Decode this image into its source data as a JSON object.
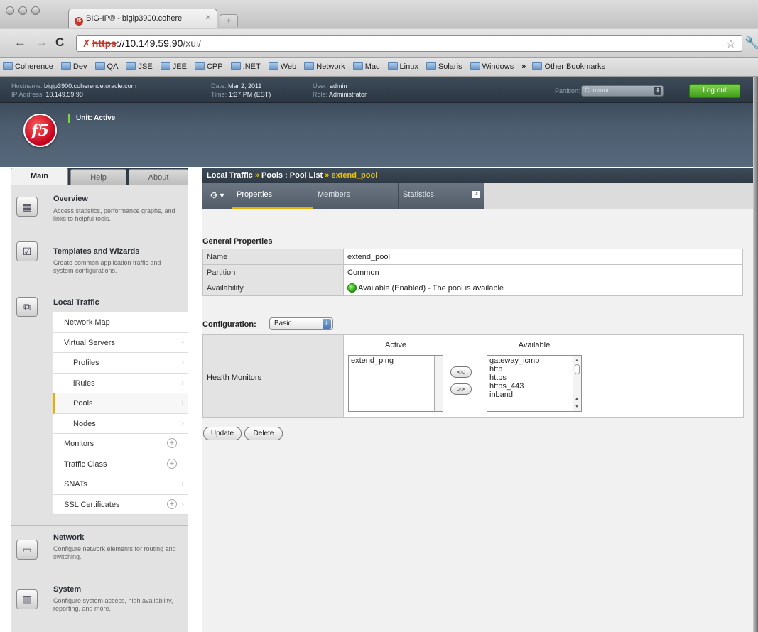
{
  "browser": {
    "tab_title": "BIG-IP® - bigip3900.cohere",
    "tab_close": "✕",
    "url_scheme": "https",
    "url_host": "://10.149.59.90",
    "url_path": "/xui/",
    "bookmarks": [
      "Coherence",
      "Dev",
      "QA",
      "JSE",
      "JEE",
      "CPP",
      ".NET",
      "Web",
      "Network",
      "Mac",
      "Linux",
      "Solaris",
      "Windows"
    ],
    "bookmarks_more": "»",
    "other_bookmarks": "Other Bookmarks"
  },
  "header": {
    "hostname_label": "Hostname:",
    "hostname": "bigip3900.coherence.oracle.com",
    "ip_label": "IP Address:",
    "ip": "10.149.59.90",
    "date_label": "Date:",
    "date": "Mar 2, 2011",
    "time_label": "Time:",
    "time": "1:37 PM (EST)",
    "user_label": "User:",
    "user": "admin",
    "role_label": "Role:",
    "role": "Administrator",
    "partition_label": "Partition:",
    "partition_value": "Common",
    "logout_label": "Log out",
    "unit_status": "Unit: Active",
    "logo_text": "f5"
  },
  "left_tabs": [
    "Main",
    "Help",
    "About"
  ],
  "sidebar": {
    "sections": [
      {
        "title": "Overview",
        "desc": "Access statistics, performance graphs, and links to helpful tools."
      },
      {
        "title": "Templates and Wizards",
        "desc": "Create common application traffic and system configurations."
      },
      {
        "title": "Local Traffic",
        "desc": ""
      },
      {
        "title": "Network",
        "desc": "Configure network elements for routing and switching."
      },
      {
        "title": "System",
        "desc": "Configure system access, high availability, reporting, and more."
      }
    ],
    "local_traffic_items": [
      "Network Map",
      "Virtual Servers",
      "Profiles",
      "iRules",
      "Pools",
      "Nodes",
      "Monitors",
      "Traffic Class",
      "SNATs",
      "SSL Certificates"
    ],
    "selected_item": "Pools"
  },
  "breadcrumb": {
    "part1": "Local Traffic",
    "sep1": "»",
    "part2": "Pools : Pool List",
    "sep2": "»",
    "current": "extend_pool"
  },
  "subtabs": [
    "Properties",
    "Members",
    "Statistics"
  ],
  "general": {
    "title": "General Properties",
    "rows": [
      {
        "label": "Name",
        "value": "extend_pool"
      },
      {
        "label": "Partition",
        "value": "Common"
      },
      {
        "label": "Availability",
        "value": "Available (Enabled) - The pool is available"
      }
    ]
  },
  "configuration": {
    "label": "Configuration:",
    "value": "Basic"
  },
  "health_monitors": {
    "label": "Health Monitors",
    "active_header": "Active",
    "available_header": "Available",
    "active": [
      "extend_ping"
    ],
    "available": [
      "gateway_icmp",
      "http",
      "https",
      "https_443",
      "inband"
    ],
    "move_left": "<<",
    "move_right": ">>"
  },
  "actions": {
    "update": "Update",
    "delete": "Delete"
  }
}
